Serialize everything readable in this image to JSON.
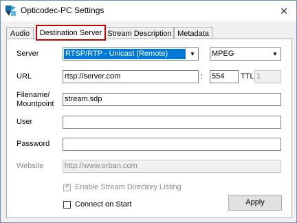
{
  "window": {
    "title": "Opticodec-PC Settings",
    "close_glyph": "✕"
  },
  "tabs": [
    {
      "label": "Audio",
      "active": false
    },
    {
      "label": "Destination Server",
      "active": true
    },
    {
      "label": "Stream Description",
      "active": false
    },
    {
      "label": "Metadata",
      "active": false
    }
  ],
  "form": {
    "server_label": "Server",
    "server_value": "RTSP/RTP - Unicast (Remote)",
    "format_value": "MPEG",
    "url_label": "URL",
    "url_value": "rtsp://server.com",
    "colon": ":",
    "port_value": "554",
    "ttl_label": "TTL",
    "ttl_value": "1",
    "filename_label_1": "Filename/",
    "filename_label_2": "Mountpoint",
    "filename_value": "stream.sdp",
    "user_label": "User",
    "user_value": "",
    "password_label": "Password",
    "password_value": "",
    "website_label": "Website",
    "website_value": "http://www.orban.com",
    "directory_listing_label": "Enable Stream Directory Listing",
    "directory_listing_checked": true,
    "connect_on_start_label": "Connect on Start",
    "connect_on_start_checked": false,
    "apply_label": "Apply"
  },
  "icons": {
    "app": "opticodec-app-icon",
    "dropdown": "chevron-down-icon",
    "close": "close-icon"
  },
  "colors": {
    "active_tab_border": "#c00000",
    "selection": "#0078d7"
  }
}
